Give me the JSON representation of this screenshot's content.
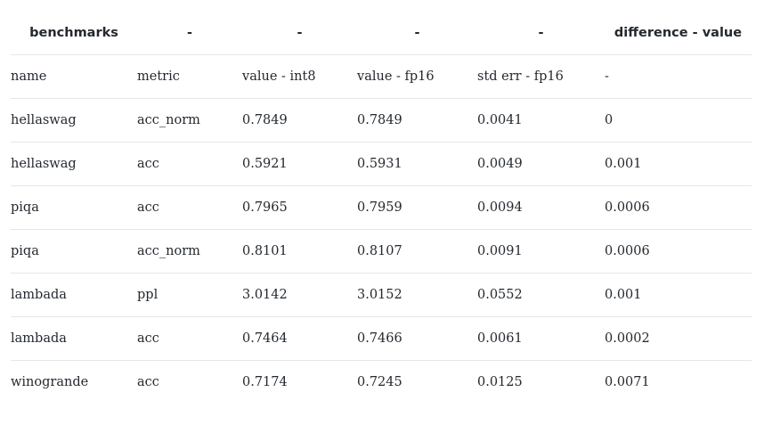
{
  "table": {
    "header": [
      "benchmarks",
      "-",
      "-",
      "-",
      "-",
      "difference - value"
    ],
    "rows": [
      [
        "name",
        "metric",
        "value - int8",
        "value - fp16",
        "std err - fp16",
        "-"
      ],
      [
        "hellaswag",
        "acc_norm",
        "0.7849",
        "0.7849",
        "0.0041",
        "0"
      ],
      [
        "hellaswag",
        "acc",
        "0.5921",
        "0.5931",
        "0.0049",
        "0.001"
      ],
      [
        "piqa",
        "acc",
        "0.7965",
        "0.7959",
        "0.0094",
        "0.0006"
      ],
      [
        "piqa",
        "acc_norm",
        "0.8101",
        "0.8107",
        "0.0091",
        "0.0006"
      ],
      [
        "lambada",
        "ppl",
        "3.0142",
        "3.0152",
        "0.0552",
        "0.001"
      ],
      [
        "lambada",
        "acc",
        "0.7464",
        "0.7466",
        "0.0061",
        "0.0002"
      ],
      [
        "winogrande",
        "acc",
        "0.7174",
        "0.7245",
        "0.0125",
        "0.0071"
      ]
    ]
  }
}
